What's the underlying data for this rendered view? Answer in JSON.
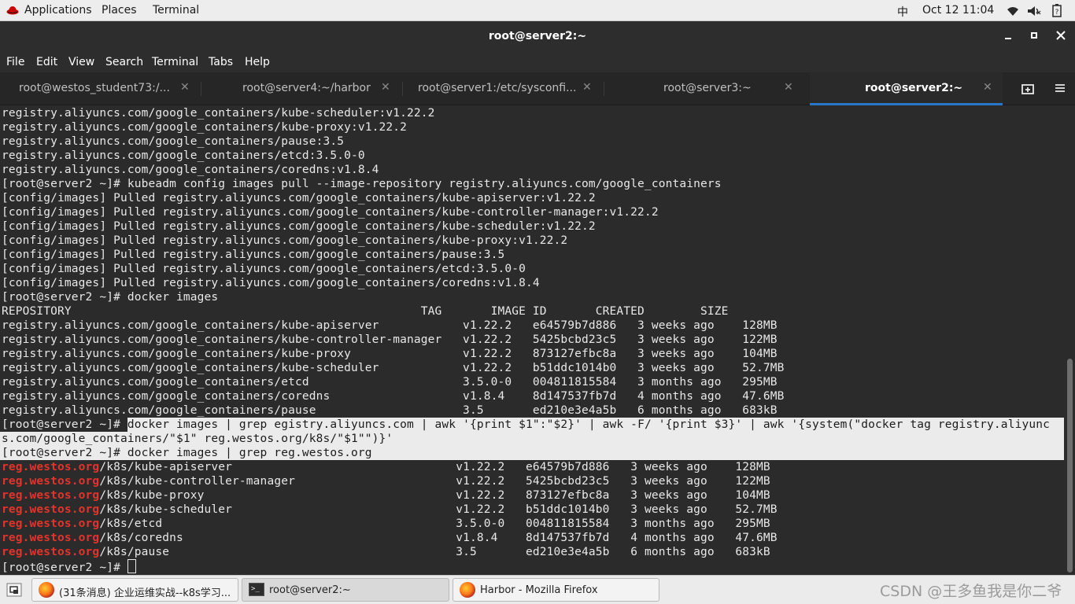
{
  "topbar": {
    "applications": "Applications",
    "places": "Places",
    "terminal": "Terminal",
    "input_method": "中",
    "datetime": "Oct 12  11:04"
  },
  "window": {
    "title": "root@server2:~"
  },
  "menubar": [
    "File",
    "Edit",
    "View",
    "Search",
    "Terminal",
    "Tabs",
    "Help"
  ],
  "tabs": [
    {
      "label": "root@westos_student73:/...",
      "active": false
    },
    {
      "label": "root@server4:~/harbor",
      "active": false
    },
    {
      "label": "root@server1:/etc/sysconfi...",
      "active": false
    },
    {
      "label": "root@server3:~",
      "active": false
    },
    {
      "label": "root@server2:~",
      "active": true
    }
  ],
  "terminal": {
    "lines": [
      "registry.aliyuncs.com/google_containers/kube-scheduler:v1.22.2",
      "registry.aliyuncs.com/google_containers/kube-proxy:v1.22.2",
      "registry.aliyuncs.com/google_containers/pause:3.5",
      "registry.aliyuncs.com/google_containers/etcd:3.5.0-0",
      "registry.aliyuncs.com/google_containers/coredns:v1.8.4",
      "[root@server2 ~]# kubeadm config images pull --image-repository registry.aliyuncs.com/google_containers",
      "[config/images] Pulled registry.aliyuncs.com/google_containers/kube-apiserver:v1.22.2",
      "[config/images] Pulled registry.aliyuncs.com/google_containers/kube-controller-manager:v1.22.2",
      "[config/images] Pulled registry.aliyuncs.com/google_containers/kube-scheduler:v1.22.2",
      "[config/images] Pulled registry.aliyuncs.com/google_containers/kube-proxy:v1.22.2",
      "[config/images] Pulled registry.aliyuncs.com/google_containers/pause:3.5",
      "[config/images] Pulled registry.aliyuncs.com/google_containers/etcd:3.5.0-0",
      "[config/images] Pulled registry.aliyuncs.com/google_containers/coredns:v1.8.4",
      "[root@server2 ~]# docker images",
      "REPOSITORY                                                  TAG       IMAGE ID       CREATED        SIZE",
      "registry.aliyuncs.com/google_containers/kube-apiserver            v1.22.2   e64579b7d886   3 weeks ago    128MB",
      "registry.aliyuncs.com/google_containers/kube-controller-manager   v1.22.2   5425bcbd23c5   3 weeks ago    122MB",
      "registry.aliyuncs.com/google_containers/kube-proxy                v1.22.2   873127efbc8a   3 weeks ago    104MB",
      "registry.aliyuncs.com/google_containers/kube-scheduler            v1.22.2   b51ddc1014b0   3 weeks ago    52.7MB",
      "registry.aliyuncs.com/google_containers/etcd                      3.5.0-0   004811815584   3 months ago   295MB",
      "registry.aliyuncs.com/google_containers/coredns                   v1.8.4    8d147537fb7d   4 months ago   47.6MB",
      "registry.aliyuncs.com/google_containers/pause                     3.5       ed210e3e4a5b   6 months ago   683kB"
    ],
    "selected_lines": [
      "[root@server2 ~]# docker images | grep egistry.aliyuncs.com | awk '{print $1\":\"$2}' | awk -F/ '{print $3}' | awk '{system(\"docker tag registry.aliyunc",
      "s.com/google_containers/\"$1\" reg.westos.org/k8s/\"$1\"\")}'",
      "[root@server2 ~]# docker images | grep reg.westos.org"
    ],
    "reg_host": "reg.westos.org",
    "reg_rows": [
      "/k8s/kube-apiserver                                v1.22.2   e64579b7d886   3 weeks ago    128MB",
      "/k8s/kube-controller-manager                       v1.22.2   5425bcbd23c5   3 weeks ago    122MB",
      "/k8s/kube-proxy                                    v1.22.2   873127efbc8a   3 weeks ago    104MB",
      "/k8s/kube-scheduler                                v1.22.2   b51ddc1014b0   3 weeks ago    52.7MB",
      "/k8s/etcd                                          3.5.0-0   004811815584   3 months ago   295MB",
      "/k8s/coredns                                       v1.8.4    8d147537fb7d   4 months ago   47.6MB",
      "/k8s/pause                                         3.5       ed210e3e4a5b   6 months ago   683kB"
    ],
    "prompt": "[root@server2 ~]# "
  },
  "taskbar": {
    "items": [
      {
        "label": "(31条消息) 企业运维实战--k8s学习...",
        "icon": "firefox-icon",
        "active": false
      },
      {
        "label": "root@server2:~",
        "icon": "terminal-icon",
        "active": true
      },
      {
        "label": "Harbor - Mozilla Firefox",
        "icon": "firefox-icon",
        "active": false
      }
    ]
  },
  "watermark": "CSDN @王多鱼我是你二爷"
}
